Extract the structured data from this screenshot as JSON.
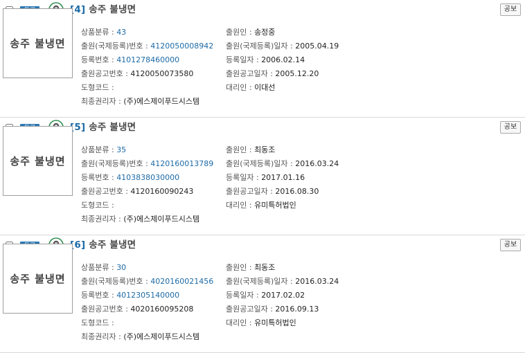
{
  "labels": {
    "category": "상품분류 : ",
    "applicant": "출원인 : ",
    "app_no": "출원(국제등록)번호 : ",
    "app_date": "출원(국제등록)일자 : ",
    "reg_no": "등록번호 : ",
    "reg_date": "등록일자 : ",
    "pub_no": "출원공고번호 : ",
    "pub_date": "출원공고일자 : ",
    "design_code": "도형코드 : ",
    "agent": "대리인 : ",
    "final_owner": "최종권리자 : "
  },
  "records": [
    {
      "status_badge": "등록",
      "index_label": "[4]",
      "title": "송주 불냉면",
      "pub_button": "공보",
      "thumbnail_text": "송주 불냉면",
      "category": "43",
      "applicant": "송정중",
      "app_no": "4120050008942",
      "app_date": "2005.04.19",
      "reg_no": "4101278460000",
      "reg_date": "2006.02.14",
      "pub_no": "4120050073580",
      "pub_date": "2005.12.20",
      "design_code": "",
      "agent": "이대선",
      "final_owner": "(주)에스제이푸드시스템"
    },
    {
      "status_badge": "등록",
      "index_label": "[5]",
      "title": "송주 불냉면",
      "pub_button": "공보",
      "thumbnail_text": "송주 불냉면",
      "category": "35",
      "applicant": "최동조",
      "app_no": "4120160013789",
      "app_date": "2016.03.24",
      "reg_no": "4103838030000",
      "reg_date": "2017.01.16",
      "pub_no": "4120160090243",
      "pub_date": "2016.08.30",
      "design_code": "",
      "agent": "유미특허법인",
      "final_owner": "(주)에스제이푸드시스템"
    },
    {
      "status_badge": "등록",
      "index_label": "[6]",
      "title": "송주 불냉면",
      "pub_button": "공보",
      "thumbnail_text": "송주 불냉면",
      "category": "30",
      "applicant": "최동조",
      "app_no": "4020160021456",
      "app_date": "2016.03.24",
      "reg_no": "4012305140000",
      "reg_date": "2017.02.02",
      "pub_no": "4020160095208",
      "pub_date": "2016.09.13",
      "design_code": "",
      "agent": "유미특허법인",
      "final_owner": "(주)에스제이푸드시스템"
    }
  ]
}
